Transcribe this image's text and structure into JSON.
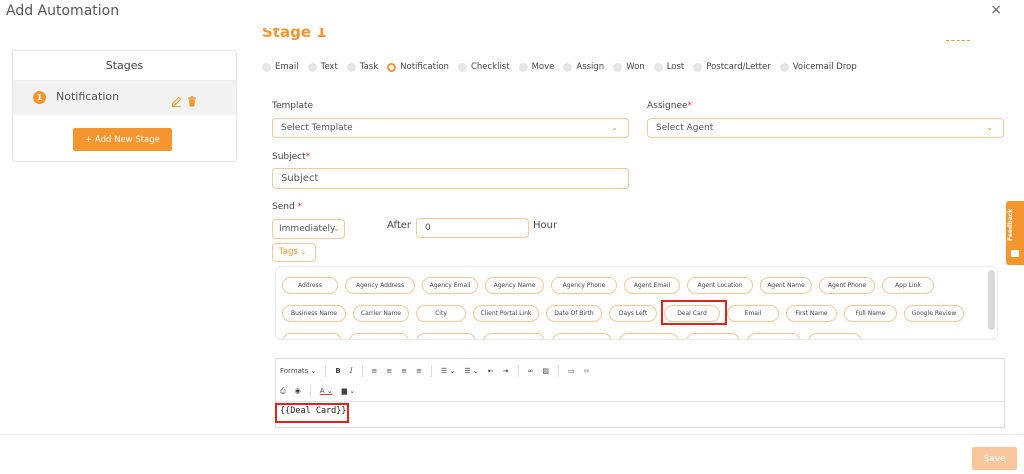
{
  "window": {
    "title": "Add Automation",
    "close_symbol": "×"
  },
  "sidebar": {
    "heading": "Stages",
    "stage": {
      "number": "1",
      "name": "Notification"
    },
    "add_stage_label": "+ Add New Stage"
  },
  "stage_header": {
    "title": "Stage 1"
  },
  "action_types": {
    "selected": "Notification",
    "options": [
      "Email",
      "Text",
      "Task",
      "Notification",
      "Checklist",
      "Move",
      "Assign",
      "Won",
      "Lost",
      "Postcard/Letter",
      "Voicemail Drop"
    ]
  },
  "form": {
    "template": {
      "label": "Template",
      "value": "Select Template"
    },
    "assignee": {
      "label": "Assignee",
      "required_mark": "*",
      "value": "Select Agent"
    },
    "subject": {
      "label": "Subject",
      "required_mark": "*",
      "placeholder": "Subject"
    },
    "send": {
      "label": "Send",
      "required_mark": " *",
      "value": "Immediately"
    },
    "after": {
      "label": "After",
      "value": "0",
      "unit": "Hour"
    },
    "tags_button": "Tags"
  },
  "tags": {
    "row1": [
      "Address",
      "Agency Address",
      "Agency Email",
      "Agency Name",
      "Agency Phone",
      "Agent Email",
      "Agent Location",
      "Agent Name",
      "Agent Phone",
      "App Link"
    ],
    "row2": [
      "Business Name",
      "Carrier Name",
      "City",
      "Client Portal Link",
      "Date Of Birth",
      "Days Left",
      "Deal Card",
      "Email",
      "First Name",
      "Full Name",
      "Google Review"
    ],
    "highlighted": "Deal Card"
  },
  "editor": {
    "formats_label": "Formats",
    "content": "{{Deal Card}}"
  },
  "footer": {
    "save_label": "Save"
  },
  "feedback": {
    "label": "Feedback"
  },
  "colors": {
    "accent": "#f5952d",
    "highlight": "#e2231a",
    "save_disabled": "#f9c79b"
  }
}
